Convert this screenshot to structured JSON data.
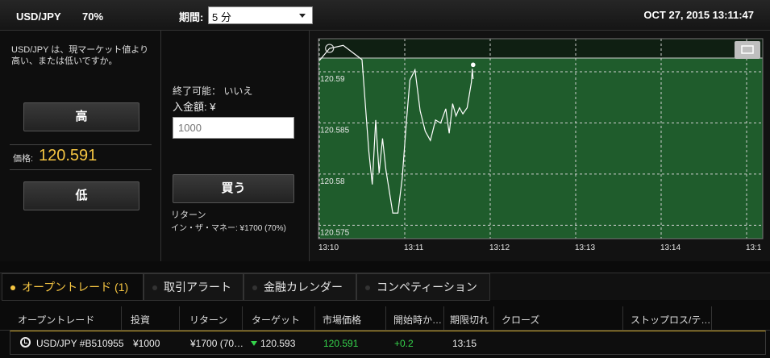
{
  "header": {
    "symbol": "USD/JPY",
    "payout": "70%",
    "period_label": "期間:",
    "period_value": "5 分",
    "datetime": "OCT 27, 2015 13:11:47"
  },
  "left": {
    "question": "USD/JPY は、現マーケット値より高い、または低いですか。",
    "high_label": "高",
    "low_label": "低",
    "price_label": "価格:",
    "price_value": "120.591"
  },
  "middle": {
    "expire_text": "終了可能： いいえ",
    "deposit_label": "入金額: ¥",
    "amount_placeholder": "1000",
    "buy_label": "買う",
    "return_label": "リターン",
    "itm_text": "イン・ザ・マネー: ¥1700 (70%)"
  },
  "chart_data": {
    "type": "line",
    "y_ticks": [
      "120.59",
      "120.585",
      "120.58",
      "120.575"
    ],
    "x_ticks": [
      "13:10",
      "13:11",
      "13:12",
      "13:13",
      "13:14",
      "13:1"
    ],
    "ylim": [
      120.574,
      120.5915
    ],
    "target_value": 120.593,
    "series": [
      {
        "points": [
          [
            0.0,
            120.5914
          ],
          [
            0.12,
            120.5926
          ],
          [
            0.28,
            120.5929
          ],
          [
            0.5,
            120.5915
          ],
          [
            0.58,
            120.5825
          ],
          [
            0.62,
            120.5793
          ],
          [
            0.66,
            120.5856
          ],
          [
            0.7,
            120.5804
          ],
          [
            0.74,
            120.5838
          ],
          [
            0.78,
            120.5807
          ],
          [
            0.82,
            120.5786
          ],
          [
            0.86,
            120.5765
          ],
          [
            0.92,
            120.5765
          ],
          [
            0.97,
            120.5799
          ],
          [
            1.02,
            120.5855
          ],
          [
            1.06,
            120.5895
          ],
          [
            1.12,
            120.5905
          ],
          [
            1.18,
            120.5865
          ],
          [
            1.24,
            120.5845
          ],
          [
            1.3,
            120.5836
          ],
          [
            1.36,
            120.5856
          ],
          [
            1.42,
            120.5853
          ],
          [
            1.48,
            120.5867
          ],
          [
            1.52,
            120.5843
          ],
          [
            1.56,
            120.5872
          ],
          [
            1.6,
            120.586
          ],
          [
            1.64,
            120.5868
          ],
          [
            1.68,
            120.5862
          ],
          [
            1.73,
            120.5868
          ],
          [
            1.78,
            120.5893
          ],
          [
            1.79,
            120.5906
          ],
          [
            1.8,
            120.5896
          ]
        ]
      }
    ],
    "last_value": 120.591,
    "fill_color": "#1f5c2c",
    "line_color": "#ffffff",
    "grid": true
  },
  "tabs": [
    {
      "label": "オープントレード (1)",
      "active": true
    },
    {
      "label": "取引アラート",
      "active": false
    },
    {
      "label": "金融カレンダー",
      "active": false
    },
    {
      "label": "コンペティーション",
      "active": false
    }
  ],
  "table": {
    "headers": [
      "オープントレード",
      "投資",
      "リターン",
      "ターゲット",
      "市場価格",
      "開始時か…",
      "期限切れ",
      "クローズ",
      "ストップロス/テ…"
    ],
    "rows": [
      {
        "trade": "USD/JPY #B510955",
        "investment": "¥1000",
        "return": "¥1700 (70…",
        "target": "120.593",
        "market_price": "120.591",
        "change": "+0.2",
        "expiry": "13:15"
      }
    ]
  }
}
